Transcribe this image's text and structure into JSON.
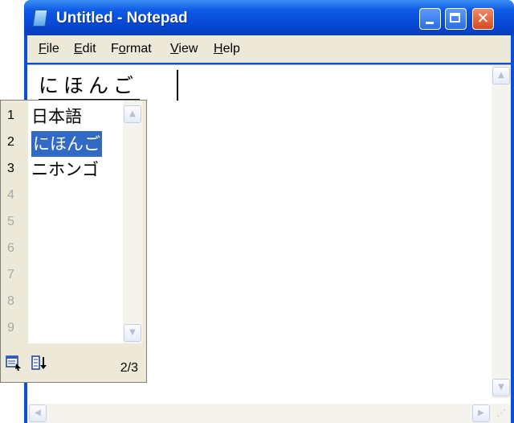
{
  "window": {
    "title": "Untitled - Notepad"
  },
  "menu": [
    {
      "pre": "",
      "u": "F",
      "post": "ile"
    },
    {
      "pre": "",
      "u": "E",
      "post": "dit"
    },
    {
      "pre": "F",
      "u": "o",
      "post": "rmat"
    },
    {
      "pre": "",
      "u": "V",
      "post": "iew"
    },
    {
      "pre": "",
      "u": "H",
      "post": "elp"
    }
  ],
  "editor": {
    "composition": "にほんご"
  },
  "ime": {
    "numbers": [
      "1",
      "2",
      "3",
      "4",
      "5",
      "6",
      "7",
      "8",
      "9"
    ],
    "candidates": [
      "日本語",
      "にほんご",
      "ニホンゴ"
    ],
    "selected_index": 1,
    "page": "2/3"
  },
  "colors": {
    "selection": "#316ac5",
    "titlebar": "#0545d2",
    "face": "#ece9d8"
  }
}
